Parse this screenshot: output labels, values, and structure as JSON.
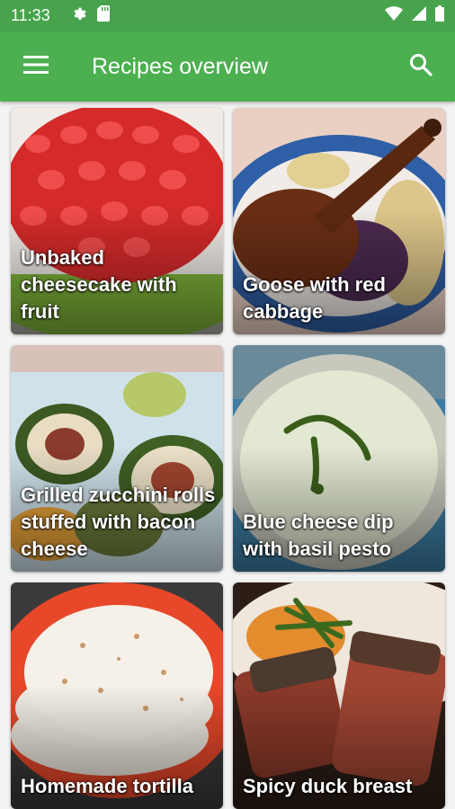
{
  "status_bar": {
    "time": "11:33",
    "icons_left": [
      "gear-icon",
      "sd-card-icon"
    ],
    "icons_right": [
      "wifi-icon",
      "signal-icon",
      "battery-icon"
    ]
  },
  "app_bar": {
    "title": "Recipes overview",
    "menu_icon": "hamburger-menu-icon",
    "search_icon": "search-icon"
  },
  "colors": {
    "status_bar": "#47a44d",
    "app_bar": "#4caf50",
    "background": "#f3f3f3"
  },
  "recipes": [
    {
      "title": "Unbaked cheesecake with fruit"
    },
    {
      "title": "Goose with red cabbage"
    },
    {
      "title": "Grilled zucchini rolls stuffed with bacon cheese"
    },
    {
      "title": "Blue cheese dip with basil pesto"
    },
    {
      "title": "Homemade tortilla"
    },
    {
      "title": "Spicy duck breast"
    }
  ]
}
